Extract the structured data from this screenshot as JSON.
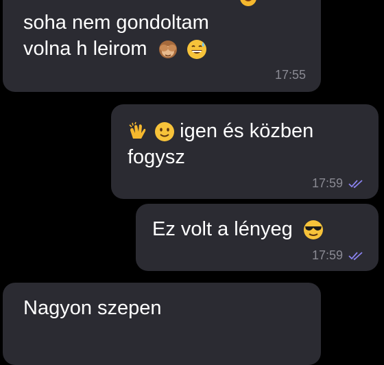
{
  "messages": [
    {
      "id": "m1",
      "direction": "incoming",
      "lines": [
        "soha nem gondoltam",
        "volna h leirom"
      ],
      "emojis": [
        "see-no-evil-monkey",
        "grinning-sweat"
      ],
      "time": "17:55"
    },
    {
      "id": "m2",
      "direction": "outgoing",
      "leading_emojis": [
        "clapping-hands",
        "slightly-smiling-face"
      ],
      "lines": [
        "igen és közben",
        "fogysz"
      ],
      "time": "17:59",
      "status": "read"
    },
    {
      "id": "m3",
      "direction": "outgoing",
      "lines": [
        "Ez volt a lényeg"
      ],
      "emojis": [
        "smiling-face-with-sunglasses"
      ],
      "time": "17:59",
      "status": "read"
    },
    {
      "id": "m4",
      "direction": "incoming",
      "lines": [
        "Nagyon szepen"
      ],
      "time": ""
    }
  ],
  "colors": {
    "background": "#000000",
    "bubble": "#2b2b32",
    "text": "#ffffff",
    "meta": "#8a8a93",
    "read_ticks": "#8b83f0"
  }
}
